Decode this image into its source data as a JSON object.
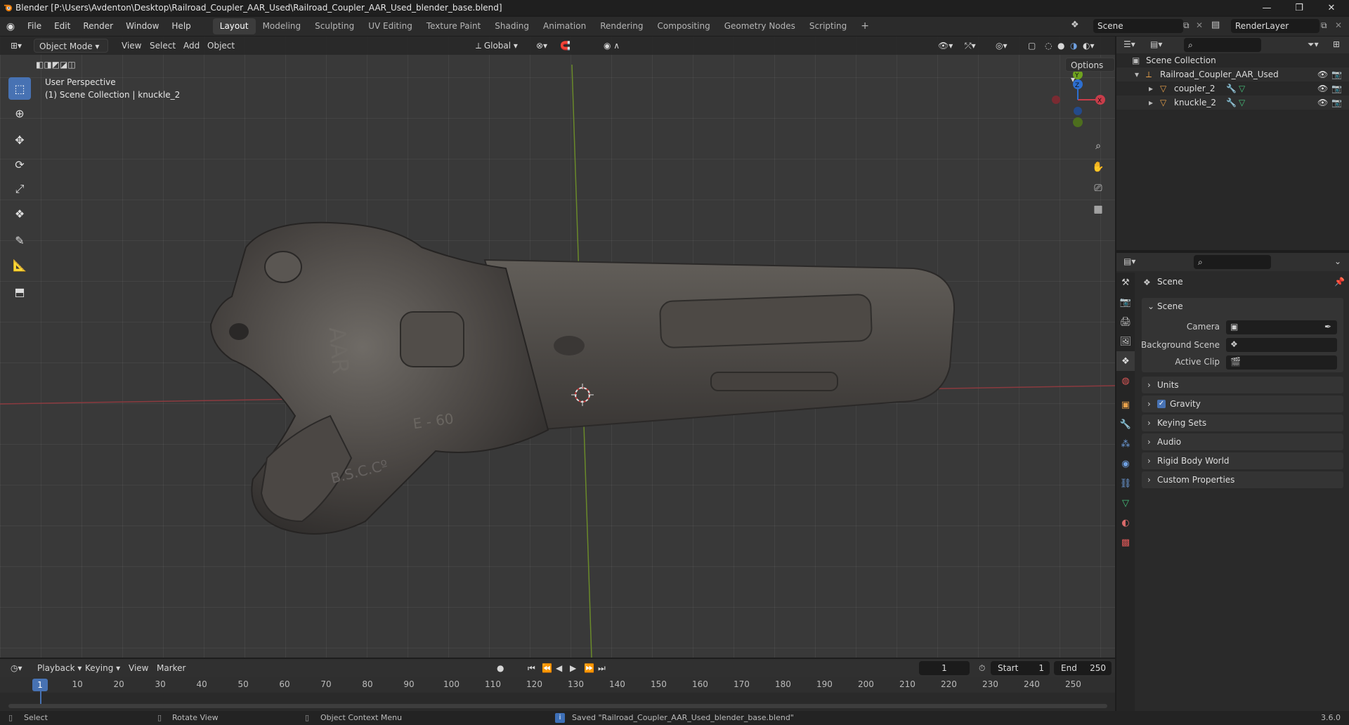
{
  "window": {
    "title": "Blender [P:\\Users\\Avdenton\\Desktop\\Railroad_Coupler_AAR_Used\\Railroad_Coupler_AAR_Used_blender_base.blend]",
    "controls": [
      "—",
      "❐",
      "✕"
    ]
  },
  "menu": [
    "File",
    "Edit",
    "Render",
    "Window",
    "Help"
  ],
  "workspaces": [
    "Layout",
    "Modeling",
    "Sculpting",
    "UV Editing",
    "Texture Paint",
    "Shading",
    "Animation",
    "Rendering",
    "Compositing",
    "Geometry Nodes",
    "Scripting"
  ],
  "workspace_add": "+",
  "scene_field": "Scene",
  "renderlayer_field": "RenderLayer",
  "viewport": {
    "mode": "Object Mode",
    "menus": [
      "View",
      "Select",
      "Add",
      "Object"
    ],
    "orientation": "Global",
    "options": "Options",
    "perspective": "User Perspective",
    "collection_info": "(1) Scene Collection | knuckle_2",
    "gizmo": {
      "x": "X",
      "y": "Y",
      "z": "Z"
    },
    "model_text": {
      "aar": "AAR",
      "model": "E - 60",
      "maker": "B.S.C.Cº"
    }
  },
  "outliner": {
    "root": "Scene Collection",
    "collection": "Railroad_Coupler_AAR_Used",
    "objects": [
      "coupler_2",
      "knuckle_2"
    ]
  },
  "properties": {
    "context": "Scene",
    "section": "Scene",
    "fields": [
      {
        "label": "Camera"
      },
      {
        "label": "Background Scene"
      },
      {
        "label": "Active Clip"
      }
    ],
    "panels": [
      "Units",
      "Gravity",
      "Keying Sets",
      "Audio",
      "Rigid Body World",
      "Custom Properties"
    ]
  },
  "timeline": {
    "menus": [
      "Playback",
      "Keying",
      "View",
      "Marker"
    ],
    "current_frame": "1",
    "start_label": "Start",
    "start": "1",
    "end_label": "End",
    "end": "250",
    "ticks": [
      "1",
      "10",
      "20",
      "30",
      "40",
      "50",
      "60",
      "70",
      "80",
      "90",
      "100",
      "110",
      "120",
      "130",
      "140",
      "150",
      "160",
      "170",
      "180",
      "190",
      "200",
      "210",
      "220",
      "230",
      "240",
      "250"
    ]
  },
  "status": {
    "select": "Select",
    "rotate": "Rotate View",
    "context_menu": "Object Context Menu",
    "message": "Saved \"Railroad_Coupler_AAR_Used_blender_base.blend\"",
    "version": "3.6.0"
  }
}
